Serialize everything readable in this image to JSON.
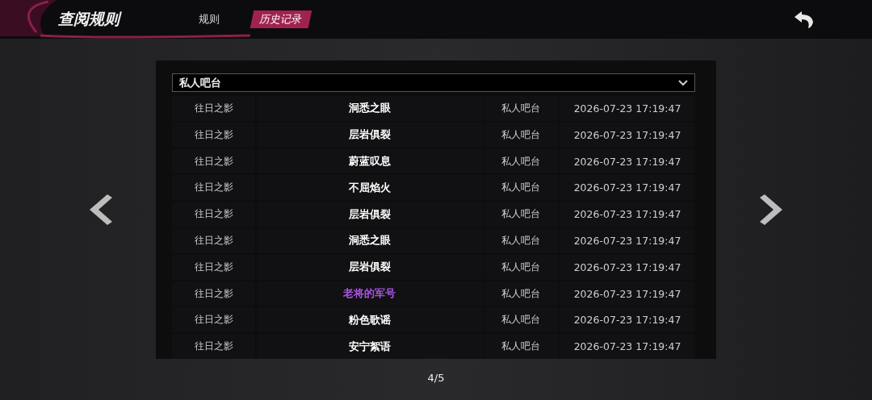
{
  "header": {
    "title": "查阅规则",
    "tabs": [
      {
        "label": "规则",
        "selected": false
      },
      {
        "label": "历史记录",
        "selected": true
      }
    ]
  },
  "filter": {
    "value": "私人吧台"
  },
  "rows": [
    {
      "pool": "往日之影",
      "item": "洞悉之眼",
      "color": "#ffffff",
      "location": "私人吧台",
      "time": "2026-07-23 17:19:47"
    },
    {
      "pool": "往日之影",
      "item": "层岩俱裂",
      "color": "#ffffff",
      "location": "私人吧台",
      "time": "2026-07-23 17:19:47"
    },
    {
      "pool": "往日之影",
      "item": "蔚蓝叹息",
      "color": "#ffffff",
      "location": "私人吧台",
      "time": "2026-07-23 17:19:47"
    },
    {
      "pool": "往日之影",
      "item": "不屈焰火",
      "color": "#ffffff",
      "location": "私人吧台",
      "time": "2026-07-23 17:19:47"
    },
    {
      "pool": "往日之影",
      "item": "层岩俱裂",
      "color": "#ffffff",
      "location": "私人吧台",
      "time": "2026-07-23 17:19:47"
    },
    {
      "pool": "往日之影",
      "item": "洞悉之眼",
      "color": "#ffffff",
      "location": "私人吧台",
      "time": "2026-07-23 17:19:47"
    },
    {
      "pool": "往日之影",
      "item": "层岩俱裂",
      "color": "#ffffff",
      "location": "私人吧台",
      "time": "2026-07-23 17:19:47"
    },
    {
      "pool": "往日之影",
      "item": "老将的军号",
      "color": "#a855e0",
      "location": "私人吧台",
      "time": "2026-07-23 17:19:47"
    },
    {
      "pool": "往日之影",
      "item": "粉色歌谣",
      "color": "#ffffff",
      "location": "私人吧台",
      "time": "2026-07-23 17:19:47"
    },
    {
      "pool": "往日之影",
      "item": "安宁絮语",
      "color": "#ffffff",
      "location": "私人吧台",
      "time": "2026-07-23 17:19:47"
    }
  ],
  "pagination": {
    "page": "4/5"
  }
}
